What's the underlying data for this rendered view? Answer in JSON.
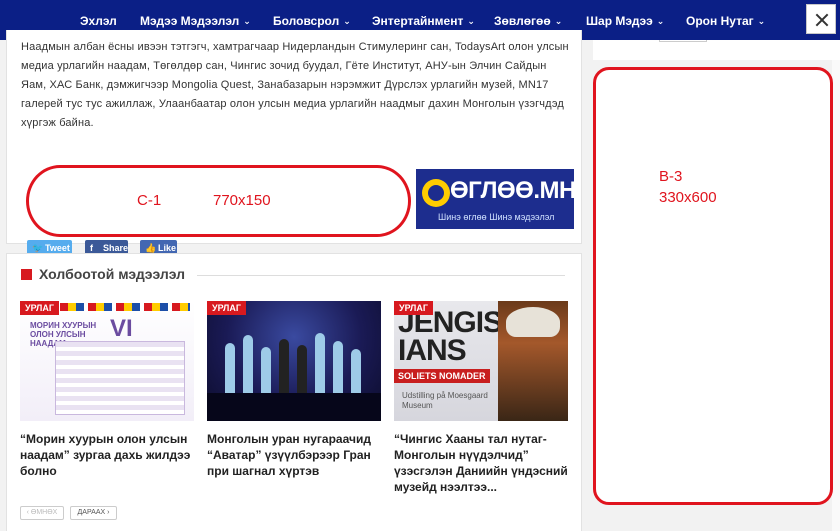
{
  "nav": {
    "items": [
      {
        "label": "Эхлэл",
        "dropdown": false
      },
      {
        "label": "Мэдээ Мэдээлэл",
        "dropdown": true
      },
      {
        "label": "Боловсрол",
        "dropdown": true
      },
      {
        "label": "Энтертайнмент",
        "dropdown": true
      },
      {
        "label": "Зөвлөгөө",
        "dropdown": true
      },
      {
        "label": "Шар Мэдээ",
        "dropdown": true
      },
      {
        "label": "Орон Нутаг",
        "dropdown": true
      }
    ],
    "chevron": "⌄"
  },
  "article": {
    "paragraph": "Наадмын албан ёсны ивээн тэтгэгч, хамтрагчаар Нидерландын Стимулеринг сан, TodaysArt олон улсын медиа урлагийн наадам, Төгөлдөр сан, Чингис зочид буудал, Гёте Институт, АНУ-ын Элчин Сайдын Яам, ХАС Банк, дэмжигчээр Mongolia Quest, Занабазарын нэрэмжит Дүрслэх урлагийн музей, MN17 галерей тус тус ажиллаж, Улаанбаатар олон улсын медиа урлагийн наадмыг дахин Монголын үзэгчдэд хүргэж байна."
  },
  "ads": {
    "c1_name": "C-1",
    "c1_size": "770x150",
    "uglu_title": "ӨГЛӨӨ.МН",
    "uglu_sub": "Шинэ өглөө Шинэ мэдээлэл",
    "b3_name": "B-3",
    "b3_size": "330x600"
  },
  "share": {
    "tweet": "Tweet",
    "fb_share": "Share",
    "fb_like": "Like"
  },
  "related": {
    "heading": "Холбоотой мэдээлэл",
    "cards": [
      {
        "badge": "УРЛАГ",
        "title": "“Морин хуурын олон улсын наадам” зургаа дахь жилдээ болно",
        "image_text": "МОРИН ХУУРЫН ОЛОН УЛСЫН НААДАМ",
        "image_numeral": "VI"
      },
      {
        "badge": "УРЛАГ",
        "title": "Монголын уран нугараачид “Аватар” үзүүлбэрээр Гран при шагнал хүртэв"
      },
      {
        "badge": "УРЛАГ",
        "title": "“Чингис Хааны тал нутаг- Монголын нүүдэлчид” үзэсгэлэн Даниийн үндэсний музейд нээлтээ...",
        "image_text": "JENGIS IANS",
        "image_banner": "SOLIETS NOMADER",
        "image_note": "Udstilling på Moesgaard Museum"
      }
    ],
    "prev": "‹ ӨМНӨХ",
    "next": "ДАРААХ ›"
  },
  "colors": {
    "nav_bg": "#0b1f86",
    "accent_red": "#d7191f",
    "ad_outline": "#e0141e",
    "twitter": "#55acee",
    "facebook": "#3b5998"
  },
  "icons": [
    "twitter-bird-icon",
    "facebook-icon",
    "thumbs-up-icon",
    "chevron-down-icon",
    "close-icon"
  ]
}
